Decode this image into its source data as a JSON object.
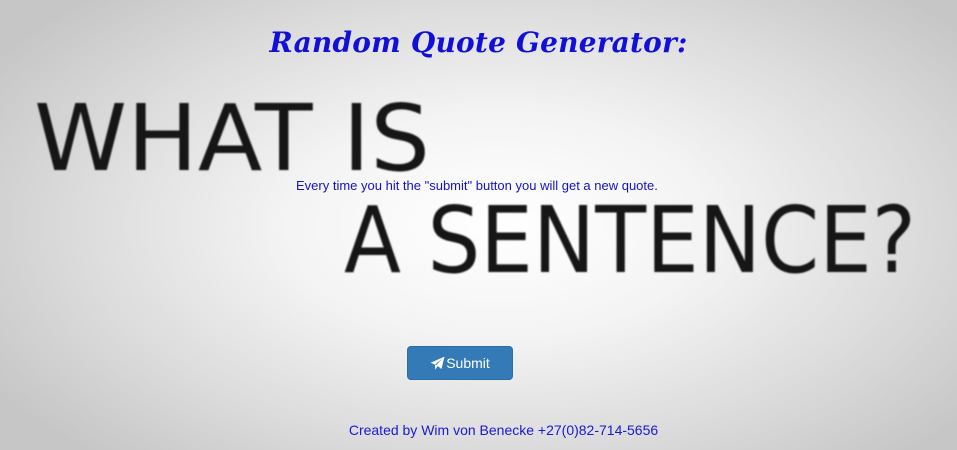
{
  "header": {
    "title": "Random Quote Generator:"
  },
  "background_image": {
    "line1": "WHAT IS",
    "line2": "A SENTENCE?"
  },
  "main": {
    "instructions": "Every time you hit the \"submit\" button you will get a new quote.",
    "submit_label": "Submit",
    "submit_icon": "paper-plane-icon"
  },
  "footer": {
    "credit": "Created by Wim von Benecke +27(0)82-714-5656"
  },
  "colors": {
    "title": "#1010d8",
    "text": "#1212c8",
    "button": "#337ab7",
    "button_text": "#ffffff"
  }
}
